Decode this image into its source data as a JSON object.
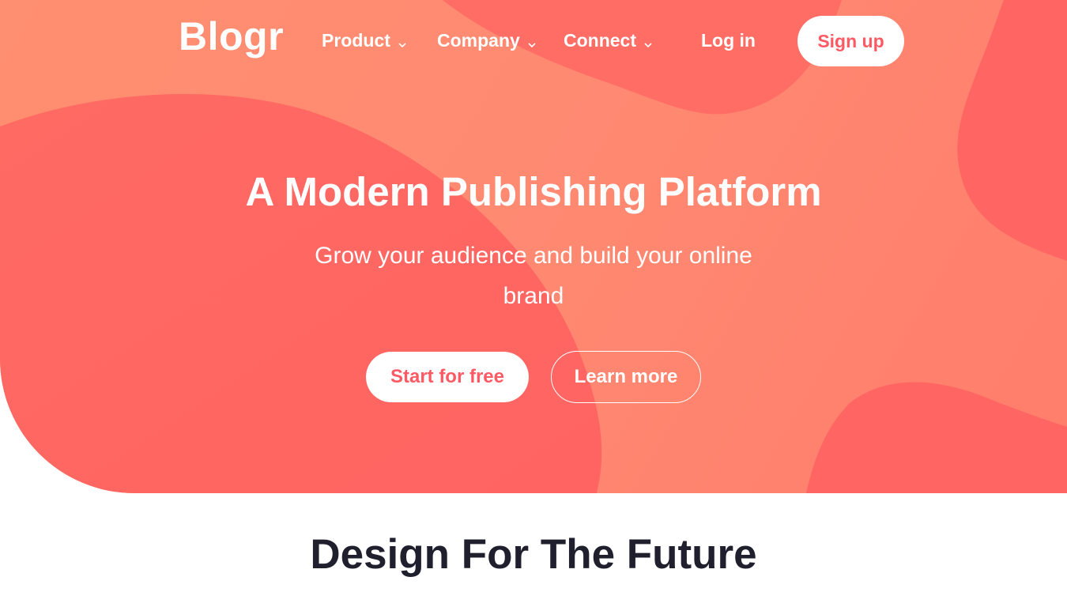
{
  "brand": {
    "logo": "Blogr",
    "accent_color": "#ff5a64",
    "hero_color_light": "#ff8f70",
    "hero_color_dark": "#ff6563"
  },
  "nav": {
    "items": [
      {
        "label": "Product",
        "icon": "chevron-down-icon"
      },
      {
        "label": "Company",
        "icon": "chevron-down-icon"
      },
      {
        "label": "Connect",
        "icon": "chevron-down-icon"
      }
    ],
    "login_label": "Log in",
    "signup_label": "Sign up"
  },
  "hero": {
    "title": "A Modern Publishing Platform",
    "subtitle": "Grow your audience and build your online brand",
    "primary_cta": "Start for free",
    "secondary_cta": "Learn more"
  },
  "section": {
    "title": "Design For The Future"
  }
}
